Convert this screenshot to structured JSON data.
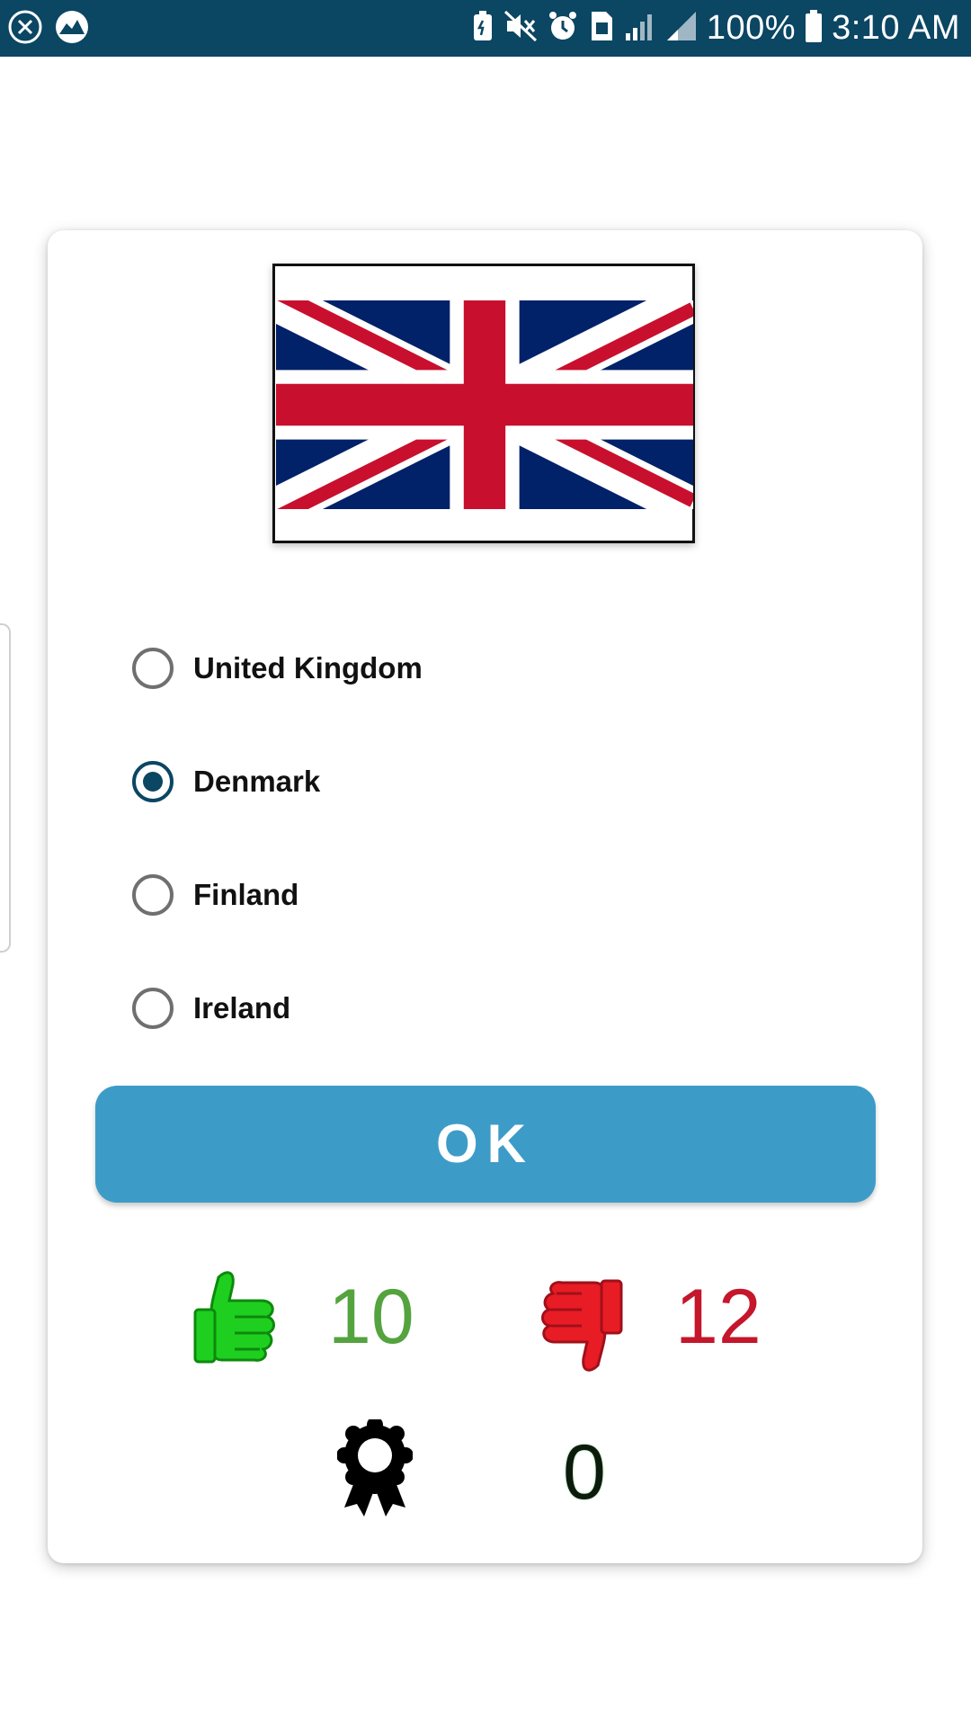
{
  "status_bar": {
    "battery_percent": "100%",
    "time": "3:10 AM",
    "left_icons": [
      "close-circle-icon",
      "app-notification-icon"
    ],
    "right_icons": [
      "battery-saver-icon",
      "mute-icon",
      "alarm-icon",
      "sim-icon",
      "signal-icon",
      "signal-icon",
      "battery-icon"
    ]
  },
  "quiz": {
    "flag": "united-kingdom-flag",
    "options": [
      {
        "label": "United Kingdom",
        "selected": false
      },
      {
        "label": "Denmark",
        "selected": true
      },
      {
        "label": "Finland",
        "selected": false
      },
      {
        "label": "Ireland",
        "selected": false
      }
    ],
    "ok_label": "OK"
  },
  "scores": {
    "correct": "10",
    "wrong": "12",
    "medals": "0"
  },
  "colors": {
    "status_bar": "#0b4663",
    "button": "#3d9cc7",
    "correct": "#54a33e",
    "wrong": "#c5162b",
    "radio_selected": "#0b4663"
  }
}
